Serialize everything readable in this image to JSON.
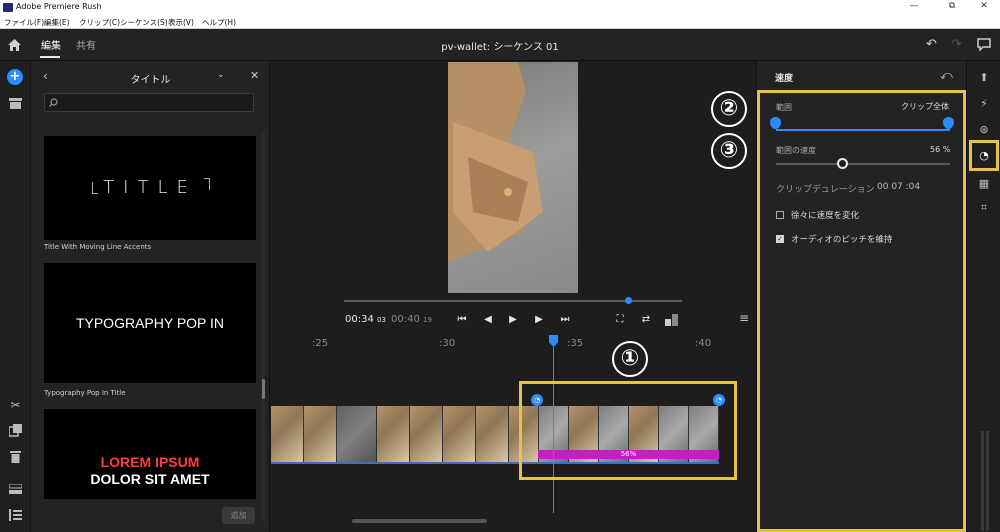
{
  "window": {
    "title": "Adobe Premiere Rush",
    "minimize": "—",
    "maximize": "⧉",
    "close": "✕"
  },
  "menu": [
    "ファイル(F)",
    "編集(E)",
    "クリップ(C)",
    "シーケンス(S)",
    "表示(V)",
    "ヘルプ(H)"
  ],
  "header": {
    "tab_edit": "編集",
    "tab_share": "共有",
    "sequence_title": "pv-wallet: シーケンス 01"
  },
  "title_panel": {
    "heading": "タイトル",
    "search_placeholder": "",
    "items": [
      {
        "preview": "TITLE",
        "caption": "Title With Moving Line Accents"
      },
      {
        "preview": "TYPOGRAPHY POP IN",
        "caption": "Typography Pop In Title"
      },
      {
        "preview_line1": "LOREM IPSUM",
        "preview_line2": "DOLOR SIT AMET"
      }
    ],
    "add_button": "追加"
  },
  "player": {
    "current_time": "00:34",
    "current_frames": "03",
    "total_time": "00:40",
    "total_frames": "19",
    "progress_percent": 84
  },
  "timeline": {
    "ruler": [
      ":25",
      ":30",
      ":35",
      ":40"
    ],
    "speed_label": "56%"
  },
  "annotations": {
    "one": "①",
    "two": "②",
    "three": "③"
  },
  "speed_panel": {
    "title": "速度",
    "range_label": "範囲",
    "range_value": "クリップ全体",
    "range_speed_label": "範囲の速度",
    "range_speed_value": "56 %",
    "range_speed_fraction": 0.38,
    "clip_duration_label": "クリップデュレーション",
    "clip_duration_value": "00  07 :04",
    "ramp_label": "徐々に速度を変化",
    "ramp_checked": false,
    "pitch_label": "オーディオのピッチを維持",
    "pitch_checked": true
  },
  "colors": {
    "accent": "#2d8cff",
    "highlight": "#e6c24a",
    "speed_bar": "#c21fc2"
  }
}
